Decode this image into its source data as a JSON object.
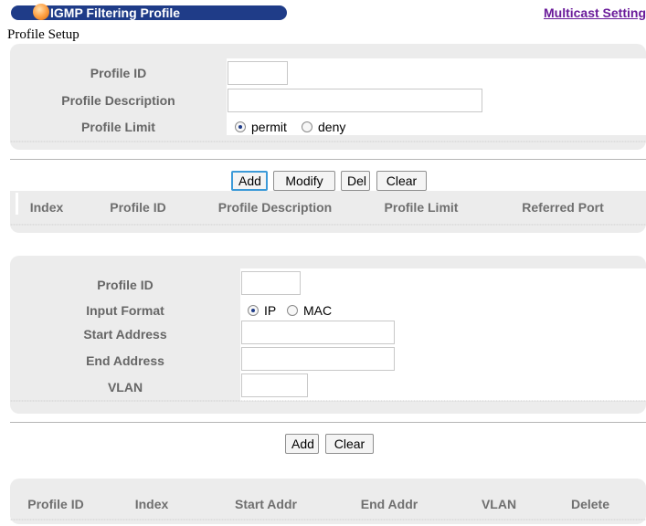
{
  "header": {
    "title": "IGMP Filtering Profile",
    "link": "Multicast Setting",
    "section": "Profile Setup"
  },
  "profile_form": {
    "profile_id_label": "Profile ID",
    "profile_id_value": "",
    "description_label": "Profile Description",
    "description_value": "",
    "limit_label": "Profile Limit",
    "limit_options": [
      "permit",
      "deny"
    ],
    "limit_selected": "permit"
  },
  "profile_buttons": {
    "add": "Add",
    "modify": "Modify",
    "del": "Del",
    "clear": "Clear"
  },
  "profile_table": {
    "columns": [
      "Index",
      "Profile ID",
      "Profile Description",
      "Profile Limit",
      "Referred Port"
    ],
    "rows": []
  },
  "address_form": {
    "profile_id_label": "Profile ID",
    "profile_id_value": "",
    "format_label": "Input Format",
    "format_options": [
      "IP",
      "MAC"
    ],
    "format_selected": "IP",
    "start_label": "Start Address",
    "start_value": "",
    "end_label": "End Address",
    "end_value": "",
    "vlan_label": "VLAN",
    "vlan_value": ""
  },
  "address_buttons": {
    "add": "Add",
    "clear": "Clear"
  },
  "address_table": {
    "columns": [
      "Profile ID",
      "Index",
      "Start Addr",
      "End Addr",
      "VLAN",
      "Delete"
    ],
    "rows": []
  },
  "colors": {
    "title_bar": "#1f3c88",
    "link": "#6a1b9a",
    "panel": "#ececec",
    "focus_border": "#3c9ad8"
  }
}
